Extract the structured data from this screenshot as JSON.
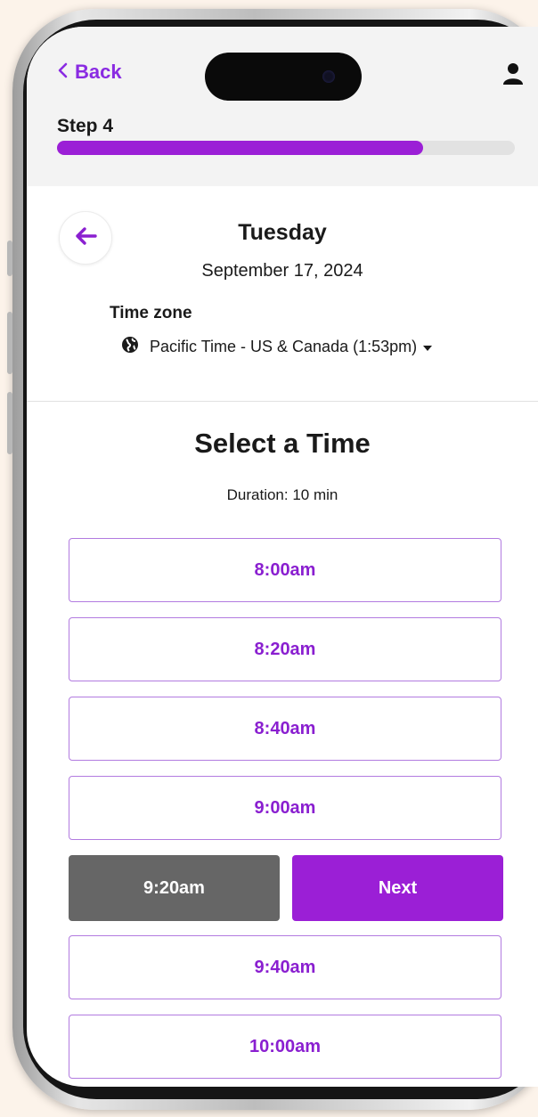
{
  "header": {
    "back_label": "Back",
    "step_label": "Step 4",
    "progress_fraction": 0.8
  },
  "date_panel": {
    "day": "Tuesday",
    "date": "September 17, 2024",
    "timezone_label": "Time zone",
    "timezone_value": "Pacific Time - US & Canada (1:53pm)"
  },
  "main": {
    "title": "Select a Time",
    "duration": "Duration: 10 min",
    "slots": [
      "8:00am",
      "8:20am",
      "8:40am",
      "9:00am",
      "9:20am",
      "9:40am",
      "10:00am"
    ],
    "selected_slot": "9:20am",
    "next_label": "Next"
  },
  "icons": {
    "back": "chevron-left-icon",
    "user": "user-icon",
    "date_back": "arrow-left-icon",
    "globe": "globe-icon",
    "dropdown": "caret-down-icon"
  },
  "colors": {
    "accent": "#9b1fd6",
    "selected_slot_bg": "#666666",
    "page_bg": "#fcf3ea"
  }
}
